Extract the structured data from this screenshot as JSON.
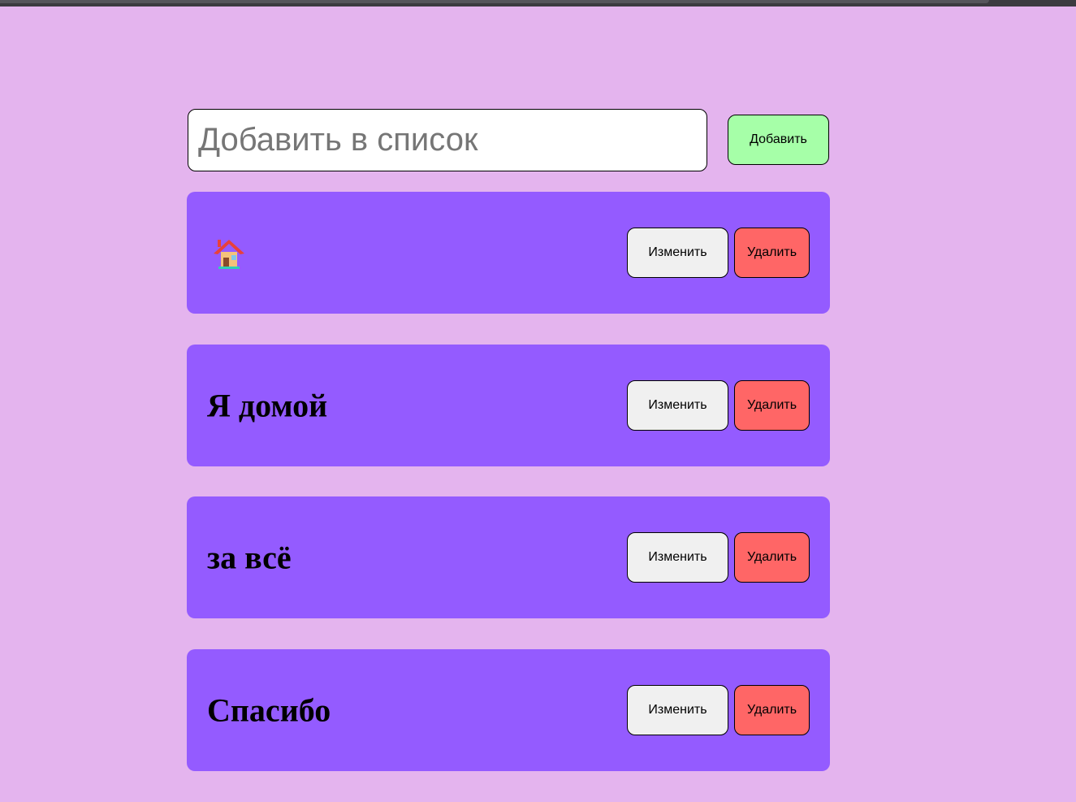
{
  "add_form": {
    "input_value": "",
    "input_placeholder": "Добавить в список",
    "add_label": "Добавить"
  },
  "items": [
    {
      "text": "",
      "icon": "house-icon",
      "edit_label": "Изменить",
      "delete_label": "Удалить"
    },
    {
      "text": "Я домой",
      "edit_label": "Изменить",
      "delete_label": "Удалить"
    },
    {
      "text": "за всё",
      "edit_label": "Изменить",
      "delete_label": "Удалить"
    },
    {
      "text": "Спасибо",
      "edit_label": "Изменить",
      "delete_label": "Удалить"
    }
  ],
  "colors": {
    "background": "#e4b4ee",
    "item_background": "#945bff",
    "add_button": "#a6ffa8",
    "edit_button": "#f0f0f0",
    "delete_button": "#ff6666"
  }
}
